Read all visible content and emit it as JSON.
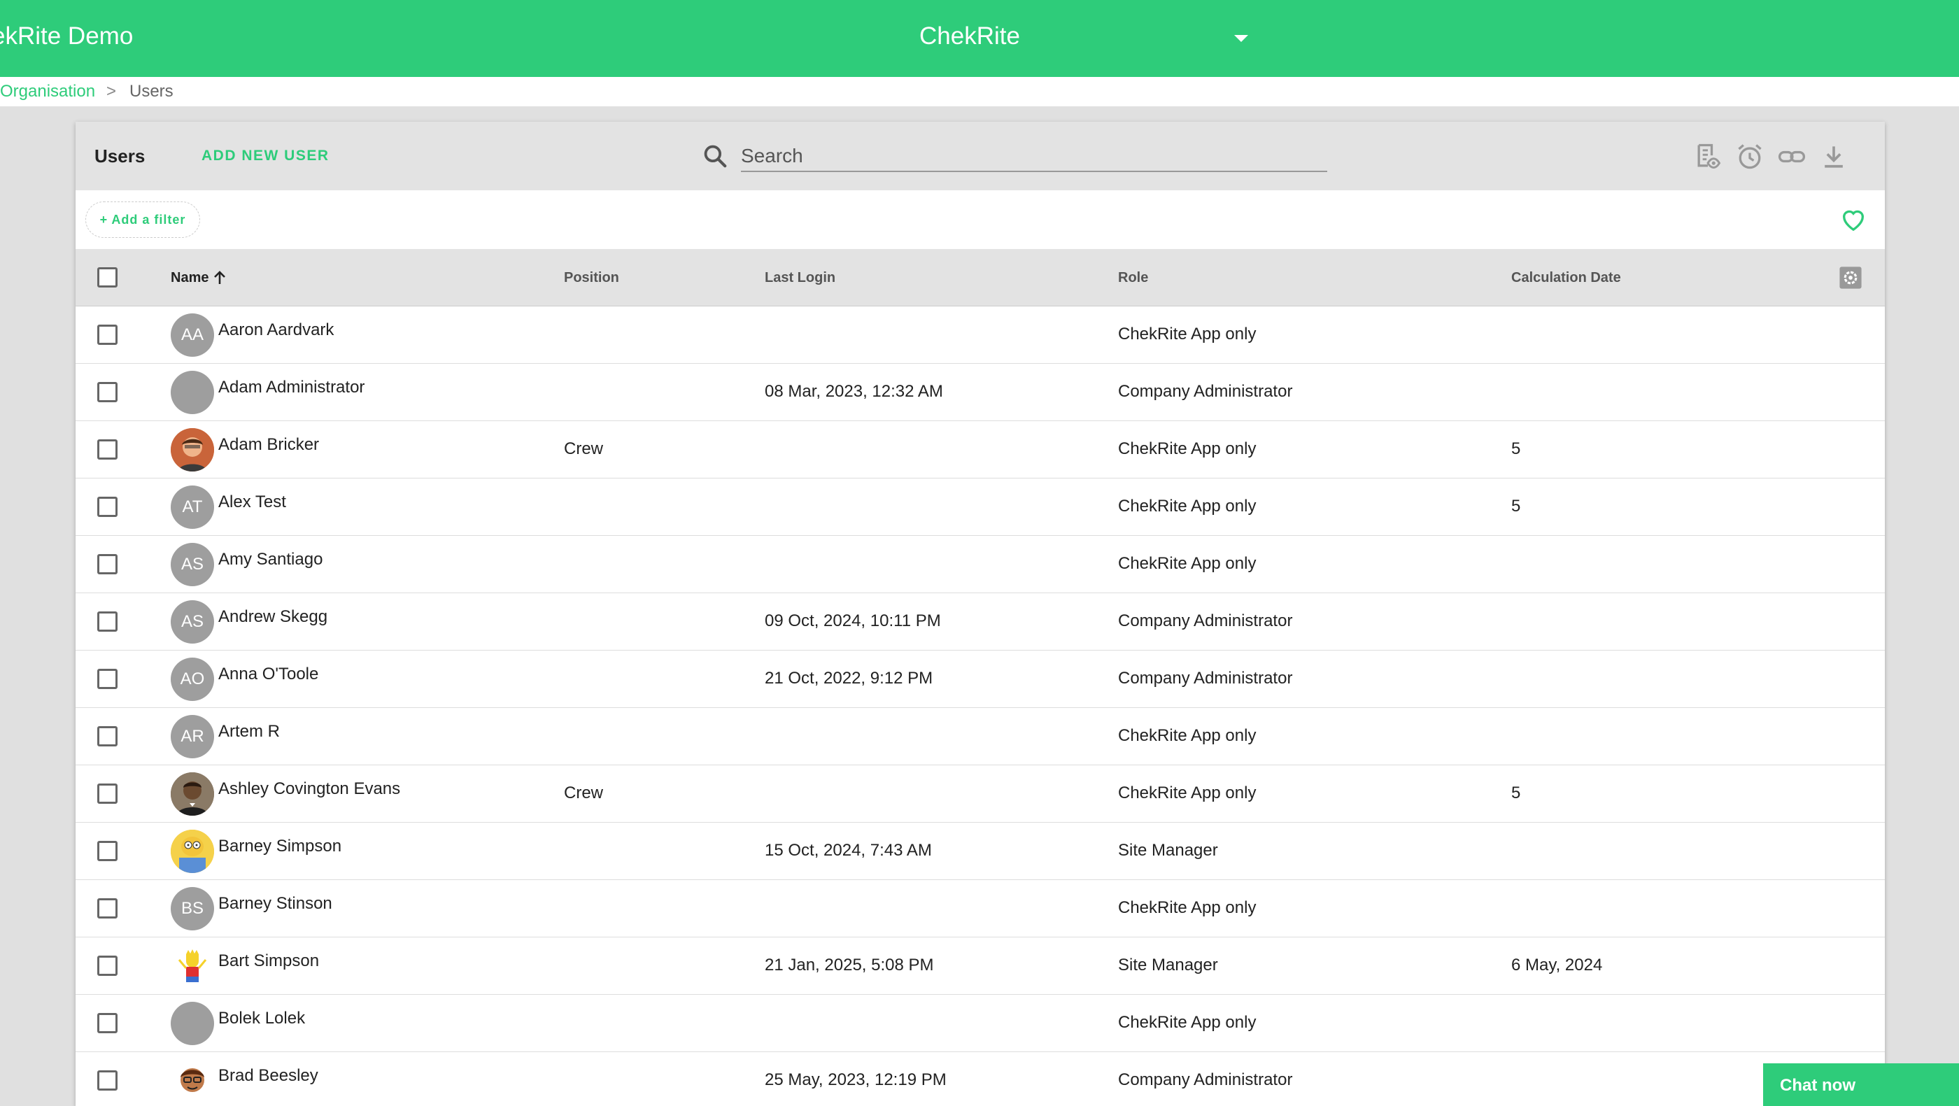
{
  "topbar": {
    "org_name": "ekRite Demo",
    "app_name": "ChekRite",
    "caret_icon": "caret-down-icon"
  },
  "breadcrumb": {
    "parent": "Organisation",
    "separator": ">",
    "current": "Users"
  },
  "toolbar": {
    "title": "Users",
    "add_user_label": "ADD NEW USER",
    "search_placeholder": "Search",
    "icons": [
      "checklist-view-icon",
      "alarm-icon",
      "link-icon",
      "download-icon"
    ]
  },
  "filters": {
    "add_filter_label": "+ Add a filter",
    "favorite_icon": "heart-icon"
  },
  "table": {
    "columns": {
      "name": "Name",
      "position": "Position",
      "last_login": "Last Login",
      "role": "Role",
      "calculation_date": "Calculation Date"
    },
    "sort": "name-ascending",
    "rows": [
      {
        "initials": "AA",
        "photo": false,
        "name": "Aaron Aardvark",
        "position": "",
        "last_login": "",
        "role": "ChekRite App only",
        "calc_date": ""
      },
      {
        "initials": "",
        "photo": false,
        "name": "Adam Administrator",
        "position": "",
        "last_login": "08 Mar, 2023, 12:32 AM",
        "role": "Company Administrator",
        "calc_date": ""
      },
      {
        "initials": "",
        "photo": true,
        "name": "Adam Bricker",
        "position": "Crew",
        "last_login": "",
        "role": "ChekRite App only",
        "calc_date": "5"
      },
      {
        "initials": "AT",
        "photo": false,
        "name": "Alex Test",
        "position": "",
        "last_login": "",
        "role": "ChekRite App only",
        "calc_date": "5"
      },
      {
        "initials": "AS",
        "photo": false,
        "name": "Amy Santiago",
        "position": "",
        "last_login": "",
        "role": "ChekRite App only",
        "calc_date": ""
      },
      {
        "initials": "AS",
        "photo": false,
        "name": "Andrew Skegg",
        "position": "",
        "last_login": "09 Oct, 2024, 10:11 PM",
        "role": "Company Administrator",
        "calc_date": ""
      },
      {
        "initials": "AO",
        "photo": false,
        "name": "Anna O'Toole",
        "position": "",
        "last_login": "21 Oct, 2022, 9:12 PM",
        "role": "Company Administrator",
        "calc_date": ""
      },
      {
        "initials": "AR",
        "photo": false,
        "name": "Artem R",
        "position": "",
        "last_login": "",
        "role": "ChekRite App only",
        "calc_date": ""
      },
      {
        "initials": "",
        "photo": true,
        "name": "Ashley Covington Evans",
        "position": "Crew",
        "last_login": "",
        "role": "ChekRite App only",
        "calc_date": "5"
      },
      {
        "initials": "",
        "photo": true,
        "name": "Barney Simpson",
        "position": "",
        "last_login": "15 Oct, 2024, 7:43 AM",
        "role": "Site Manager",
        "calc_date": ""
      },
      {
        "initials": "BS",
        "photo": false,
        "name": "Barney Stinson",
        "position": "",
        "last_login": "",
        "role": "ChekRite App only",
        "calc_date": ""
      },
      {
        "initials": "",
        "photo": true,
        "name": "Bart Simpson",
        "position": "",
        "last_login": "21 Jan, 2025, 5:08 PM",
        "role": "Site Manager",
        "calc_date": "6 May, 2024"
      },
      {
        "initials": "",
        "photo": false,
        "name": "Bolek Lolek",
        "position": "",
        "last_login": "",
        "role": "ChekRite App only",
        "calc_date": ""
      },
      {
        "initials": "",
        "photo": true,
        "name": "Brad Beesley",
        "position": "",
        "last_login": "25 May, 2023, 12:19 PM",
        "role": "Company Administrator",
        "calc_date": ""
      }
    ]
  },
  "chat": {
    "label": "Chat now"
  },
  "colors": {
    "brand_green": "#2ecc7a",
    "header_grey": "#e3e3e3",
    "avatar_grey": "#9e9e9e"
  }
}
